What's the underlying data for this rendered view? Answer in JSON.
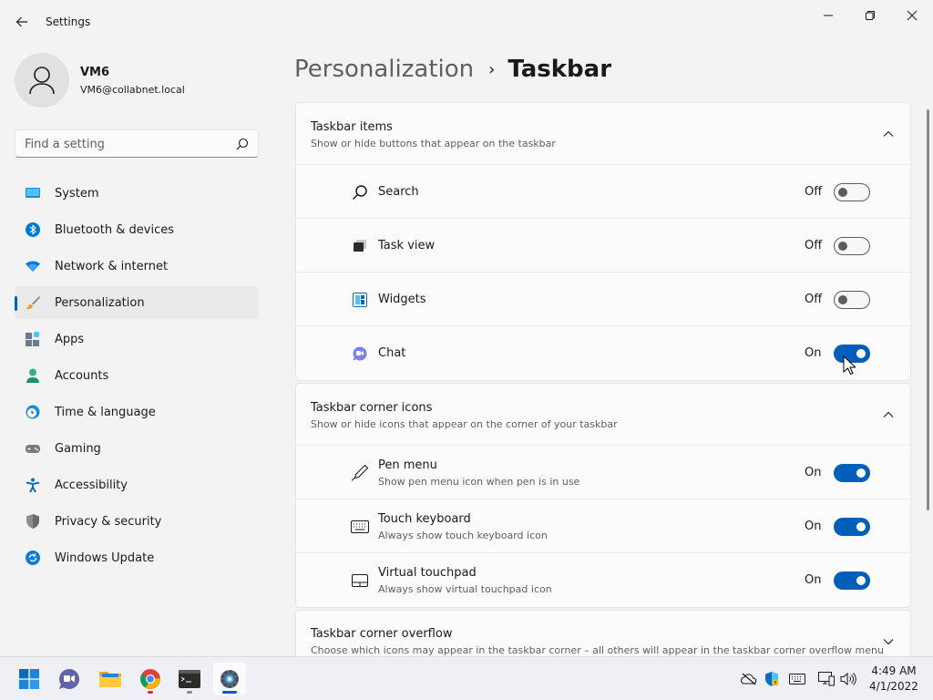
{
  "window": {
    "title": "Settings"
  },
  "profile": {
    "name": "VM6",
    "email": "VM6@collabnet.local"
  },
  "search": {
    "placeholder": "Find a setting"
  },
  "sidebar": {
    "items": [
      {
        "label": "System",
        "icon": "system-icon"
      },
      {
        "label": "Bluetooth & devices",
        "icon": "bluetooth-icon"
      },
      {
        "label": "Network & internet",
        "icon": "wifi-icon"
      },
      {
        "label": "Personalization",
        "icon": "paintbrush-icon",
        "active": true
      },
      {
        "label": "Apps",
        "icon": "apps-icon"
      },
      {
        "label": "Accounts",
        "icon": "accounts-icon"
      },
      {
        "label": "Time & language",
        "icon": "clock-globe-icon"
      },
      {
        "label": "Gaming",
        "icon": "gamepad-icon"
      },
      {
        "label": "Accessibility",
        "icon": "accessibility-icon"
      },
      {
        "label": "Privacy & security",
        "icon": "shield-icon"
      },
      {
        "label": "Windows Update",
        "icon": "update-icon"
      }
    ]
  },
  "breadcrumb": {
    "parent": "Personalization",
    "separator": "›",
    "current": "Taskbar"
  },
  "sections": {
    "taskbar_items": {
      "title": "Taskbar items",
      "subtitle": "Show or hide buttons that appear on the taskbar",
      "rows": [
        {
          "label": "Search",
          "state": "Off",
          "on": false,
          "icon": "search-icon"
        },
        {
          "label": "Task view",
          "state": "Off",
          "on": false,
          "icon": "task-view-icon"
        },
        {
          "label": "Widgets",
          "state": "Off",
          "on": false,
          "icon": "widgets-icon"
        },
        {
          "label": "Chat",
          "state": "On",
          "on": true,
          "icon": "chat-icon"
        }
      ]
    },
    "corner_icons": {
      "title": "Taskbar corner icons",
      "subtitle": "Show or hide icons that appear on the corner of your taskbar",
      "rows": [
        {
          "label": "Pen menu",
          "desc": "Show pen menu icon when pen is in use",
          "state": "On",
          "on": true,
          "icon": "pen-icon"
        },
        {
          "label": "Touch keyboard",
          "desc": "Always show touch keyboard icon",
          "state": "On",
          "on": true,
          "icon": "keyboard-icon"
        },
        {
          "label": "Virtual touchpad",
          "desc": "Always show virtual touchpad icon",
          "state": "On",
          "on": true,
          "icon": "touchpad-icon"
        }
      ]
    },
    "overflow": {
      "title": "Taskbar corner overflow",
      "subtitle": "Choose which icons may appear in the taskbar corner – all others will appear in the taskbar corner overflow menu"
    }
  },
  "taskbar": {
    "apps": [
      "start-icon",
      "teams-chat-icon",
      "file-explorer-icon",
      "chrome-icon",
      "terminal-icon",
      "settings-icon"
    ],
    "tray": [
      "onedrive-offline-icon",
      "defender-icon",
      "keyboard-icon",
      "network-icon",
      "volume-icon"
    ],
    "time": "4:49 AM",
    "date": "4/1/2022"
  },
  "colors": {
    "accent": "#005fb8",
    "background": "#f3f3f3",
    "card": "#fbfbfb"
  }
}
